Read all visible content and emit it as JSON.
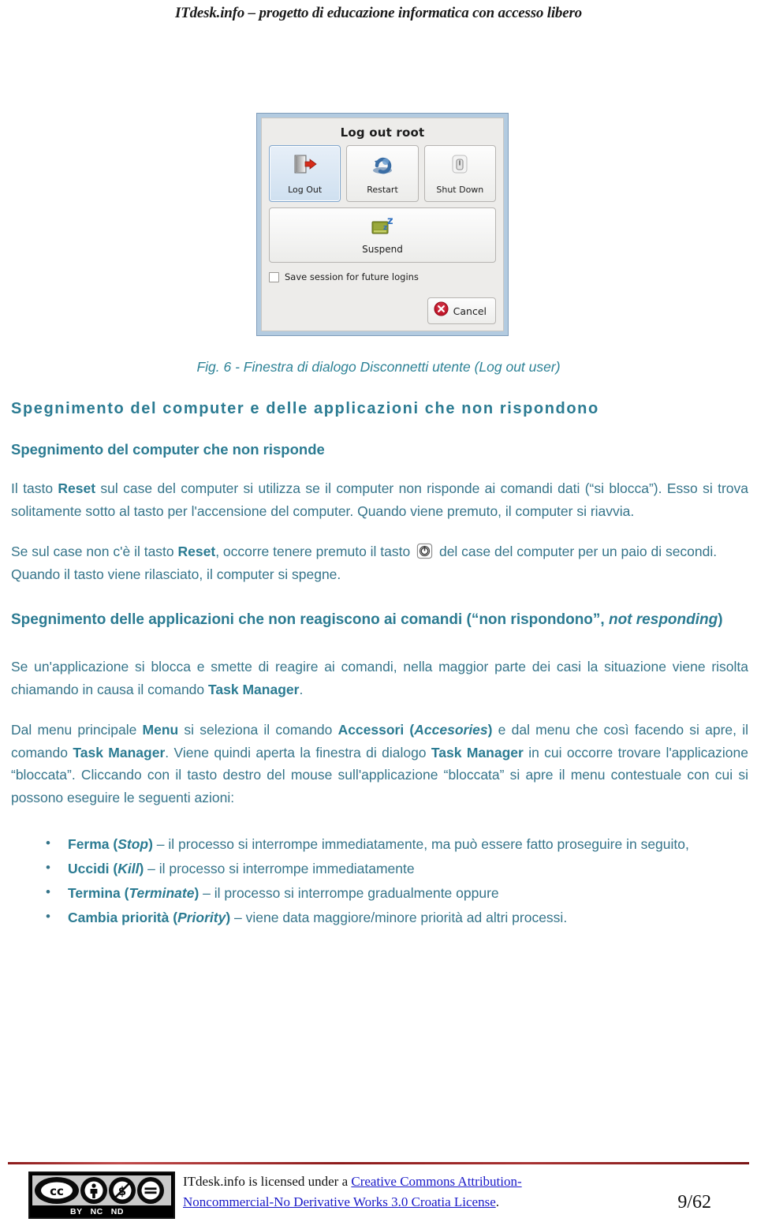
{
  "header": {
    "title": "ITdesk.info – progetto di educazione informatica con accesso libero"
  },
  "figure": {
    "dialog": {
      "title": "Log out root",
      "buttons": [
        {
          "label": "Log Out",
          "icon": "logout-door-icon",
          "selected": true
        },
        {
          "label": "Restart",
          "icon": "restart-arrows-icon",
          "selected": false
        },
        {
          "label": "Shut Down",
          "icon": "shutdown-power-icon",
          "selected": false
        }
      ],
      "suspend": {
        "label": "Suspend",
        "icon": "suspend-sleep-icon"
      },
      "checkbox": {
        "label": "Save session for future logins",
        "checked": false
      },
      "cancel": {
        "label": "Cancel",
        "icon": "cancel-x-icon"
      }
    },
    "caption": "Fig. 6 - Finestra di dialogo Disconnetti utente (Log out user)"
  },
  "content": {
    "section_heading": "Spegnimento del computer e delle applicazioni che non rispondono",
    "sub_heading_1": "Spegnimento del computer che non risponde",
    "para_1": {
      "t1": "Il tasto ",
      "b1": "Reset",
      "t2": " sul case del computer si utilizza se il computer non risponde ai comandi dati (“si blocca”). Esso si trova solitamente sotto al tasto per l'accensione del computer. Quando viene premuto, il computer si riavvia."
    },
    "para_2": {
      "t1": "Se sul case non c'è il tasto ",
      "b1": "Reset",
      "t2": ", occorre tenere premuto il tasto ",
      "icon": "power-button-icon",
      "t3": " del case del computer per un paio di secondi. Quando il tasto viene rilasciato, il computer si spegne."
    },
    "sub_heading_2": {
      "t1": "Spegnimento delle applicazioni che non reagiscono ai comandi (“non rispondono”, ",
      "i1": "not responding",
      "t2": ")"
    },
    "para_3": {
      "t1": "Se un'applicazione si blocca e smette di reagire ai comandi, nella maggior parte dei casi la situazione viene risolta chiamando in causa il comando ",
      "b1": "Task Manager",
      "t2": "."
    },
    "para_4": {
      "t1": "Dal menu principale ",
      "b1": "Menu",
      "t2": " si seleziona il comando ",
      "b2": "Accessori (",
      "bi1": "Accesories",
      "b3": ")",
      "t3": " e dal menu che così facendo si apre, il comando ",
      "b4": "Task Manager",
      "t4": ". Viene quindi aperta la finestra di dialogo ",
      "b5": "Task Manager",
      "t5": " in cui occorre trovare l'applicazione “bloccata”. Cliccando con il tasto destro del mouse sull'applicazione “bloccata” si apre il menu contestuale con cui si possono eseguire le seguenti azioni:"
    },
    "bullets": [
      {
        "bold": "Ferma (",
        "bold_italic": "Stop",
        "bold_end": ")",
        "rest": " – il processo si interrompe immediatamente, ma può essere fatto proseguire in seguito,"
      },
      {
        "bold": "Uccidi (",
        "bold_italic": "Kill",
        "bold_end": ")",
        "rest": " – il processo si interrompe immediatamente"
      },
      {
        "bold": "Termina (",
        "bold_italic": "Terminate",
        "bold_end": ")",
        "rest": " – il processo  si interrompe gradualmente oppure"
      },
      {
        "bold": "Cambia priorità (",
        "bold_italic": "Priority",
        "bold_end": ")",
        "rest": " – viene data maggiore/minore priorità ad altri processi."
      }
    ]
  },
  "footer": {
    "cc_badge": {
      "main": "cc",
      "terms": [
        "BY",
        "NC",
        "ND"
      ]
    },
    "license_prefix": "ITdesk.info is licensed under a ",
    "license_link_1": "Creative Commons Attribution-",
    "license_link_2": "Noncommercial-No Derivative Works 3.0 Croatia License",
    "license_suffix": ".",
    "page_number": "9/62"
  },
  "colors": {
    "heading": "#2b7b92",
    "body": "#35748a",
    "caption": "#2d8296",
    "link": "#1919c8",
    "rule": "#8c1b1b"
  }
}
